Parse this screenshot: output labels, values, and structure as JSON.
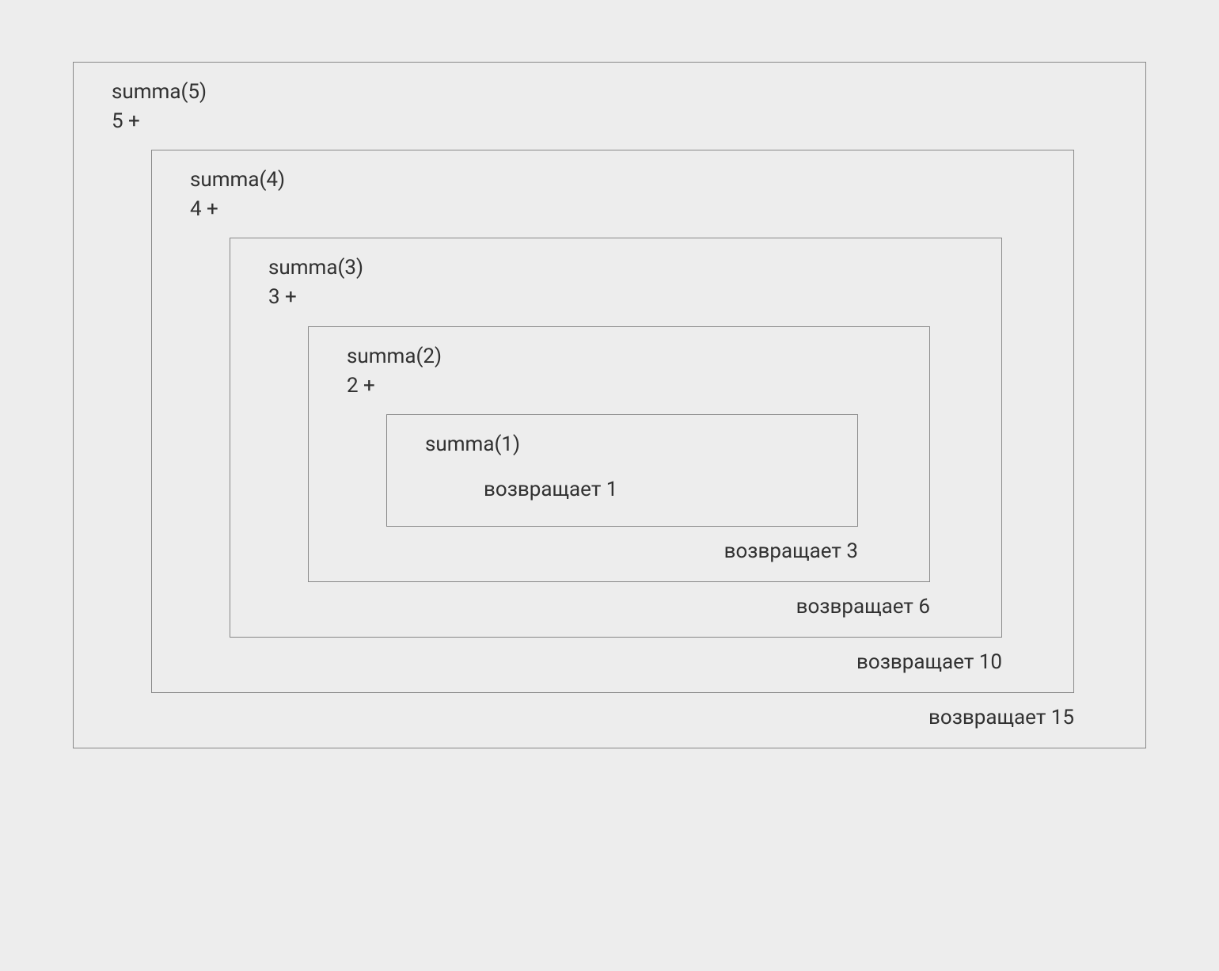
{
  "frames": [
    {
      "call": "summa(5)",
      "addend": "5 +",
      "ret": "возвращает 15"
    },
    {
      "call": "summa(4)",
      "addend": "4 +",
      "ret": "возвращает 10"
    },
    {
      "call": "summa(3)",
      "addend": "3 +",
      "ret": "возвращает 6"
    },
    {
      "call": "summa(2)",
      "addend": "2 +",
      "ret": "возвращает 3"
    },
    {
      "call": "summa(1)",
      "addend": "",
      "ret": "возвращает 1"
    }
  ]
}
